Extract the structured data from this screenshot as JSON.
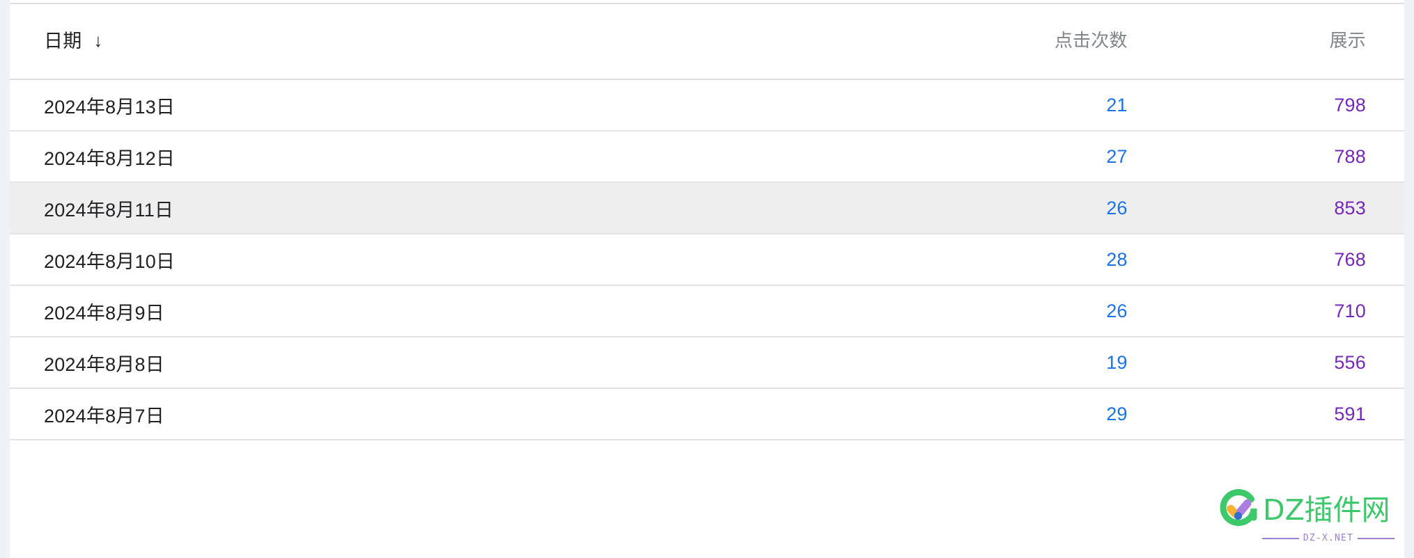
{
  "table": {
    "columns": [
      {
        "key": "date",
        "label": "日期",
        "sort_icon": "arrow-down-icon",
        "sorted": true,
        "align": "left"
      },
      {
        "key": "clicks",
        "label": "点击次数",
        "sort_icon": null,
        "sorted": false,
        "align": "right"
      },
      {
        "key": "impressions",
        "label": "展示",
        "sort_icon": null,
        "sorted": false,
        "align": "right"
      }
    ],
    "sort_direction_glyph": "↓",
    "rows": [
      {
        "date": "2024年8月13日",
        "clicks": "21",
        "impressions": "798",
        "highlighted": false
      },
      {
        "date": "2024年8月12日",
        "clicks": "27",
        "impressions": "788",
        "highlighted": false
      },
      {
        "date": "2024年8月11日",
        "clicks": "26",
        "impressions": "853",
        "highlighted": true
      },
      {
        "date": "2024年8月10日",
        "clicks": "28",
        "impressions": "768",
        "highlighted": false
      },
      {
        "date": "2024年8月9日",
        "clicks": "26",
        "impressions": "710",
        "highlighted": false
      },
      {
        "date": "2024年8月8日",
        "clicks": "19",
        "impressions": "556",
        "highlighted": false
      },
      {
        "date": "2024年8月7日",
        "clicks": "29",
        "impressions": "591",
        "highlighted": false
      }
    ]
  },
  "watermark": {
    "brand_text": "DZ插件网",
    "domain_text": "DZ-X.NET",
    "logo_icon": "dz-check-circle-icon"
  },
  "colors": {
    "page_background": "#eef2f7",
    "card_background": "#ffffff",
    "row_highlight": "#eeeeee",
    "divider": "#e3e3e3",
    "header_divider": "#dedede",
    "date_text": "#202124",
    "header_muted_text": "#80868b",
    "clicks_value": "#1a73e8",
    "impressions_value": "#7627bb",
    "watermark_green": "#3dc86a",
    "watermark_purple": "#9a7fd0"
  }
}
